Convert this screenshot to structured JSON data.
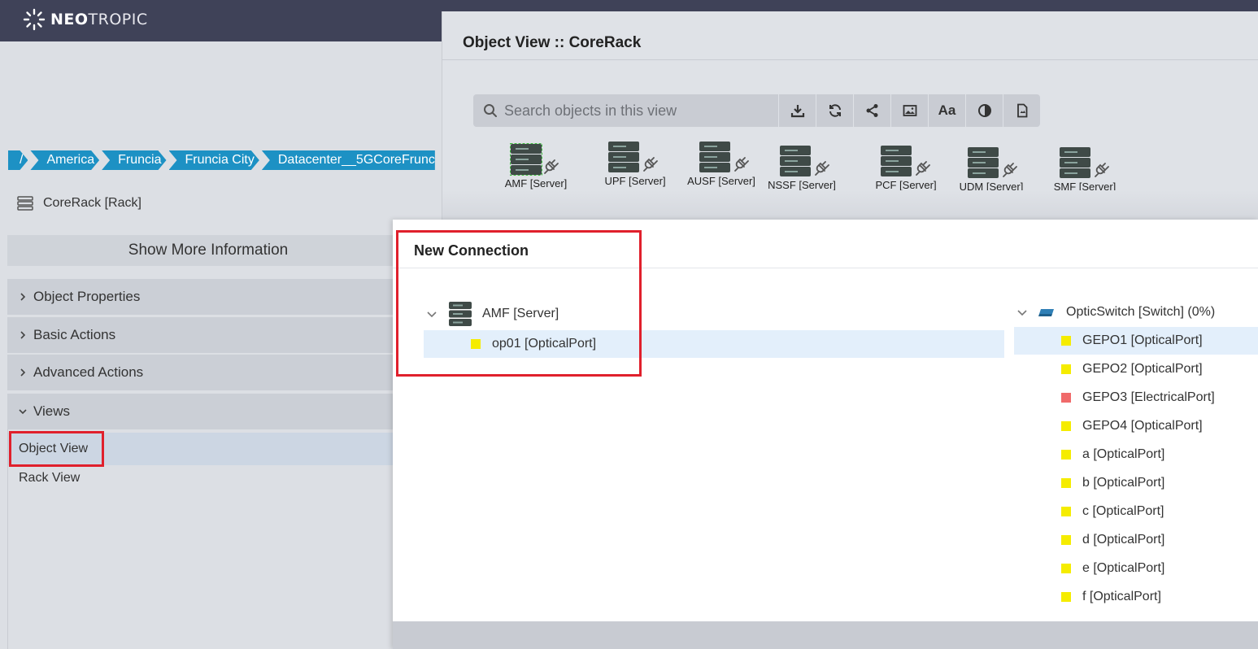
{
  "app": {
    "brand_bold": "NEO",
    "brand_rest": "TROPIC"
  },
  "breadcrumb": [
    "/",
    "America",
    "Fruncia",
    "Fruncia City",
    "Datacenter__5GCoreFrunc"
  ],
  "left": {
    "rack_title": "CoreRack [Rack]",
    "show_more": "Show More Information",
    "sections": [
      "Object Properties",
      "Basic Actions",
      "Advanced Actions",
      "Views"
    ],
    "views": [
      "Object View",
      "Rack View"
    ]
  },
  "object_view": {
    "title": "Object View :: CoreRack",
    "search_placeholder": "Search objects in this view",
    "toolbar": [
      "download-icon",
      "refresh-icon",
      "share-icon",
      "image-icon",
      "Aa",
      "contrast-icon",
      "document-icon"
    ],
    "nodes": [
      "AMF [Server]",
      "UPF [Server]",
      "AUSF [Server]",
      "NSSF [Server]",
      "PCF [Server]",
      "UDM [Server]",
      "SMF [Server]"
    ]
  },
  "new_connection": {
    "title": "New Connection",
    "left_tree": {
      "root": "AMF [Server]",
      "children": [
        {
          "label": "op01 [OpticalPort]",
          "color": "#f5ec00"
        }
      ]
    },
    "right_tree": {
      "root": "OpticSwitch [Switch] (0%)",
      "children": [
        {
          "label": "GEPO1 [OpticalPort]",
          "color": "#f5ec00"
        },
        {
          "label": "GEPO2 [OpticalPort]",
          "color": "#f5ec00"
        },
        {
          "label": "GEPO3 [ElectricalPort]",
          "color": "#f06a6a"
        },
        {
          "label": "GEPO4 [OpticalPort]",
          "color": "#f5ec00"
        },
        {
          "label": "a [OpticalPort]",
          "color": "#f5ec00"
        },
        {
          "label": "b [OpticalPort]",
          "color": "#f5ec00"
        },
        {
          "label": "c [OpticalPort]",
          "color": "#f5ec00"
        },
        {
          "label": "d [OpticalPort]",
          "color": "#f5ec00"
        },
        {
          "label": "e [OpticalPort]",
          "color": "#f5ec00"
        },
        {
          "label": "f [OpticalPort]",
          "color": "#f5ec00"
        }
      ]
    }
  },
  "colors": {
    "topbar": "#3f4258",
    "breadcrumb": "#1d91c4",
    "highlight": "#e0202c"
  }
}
